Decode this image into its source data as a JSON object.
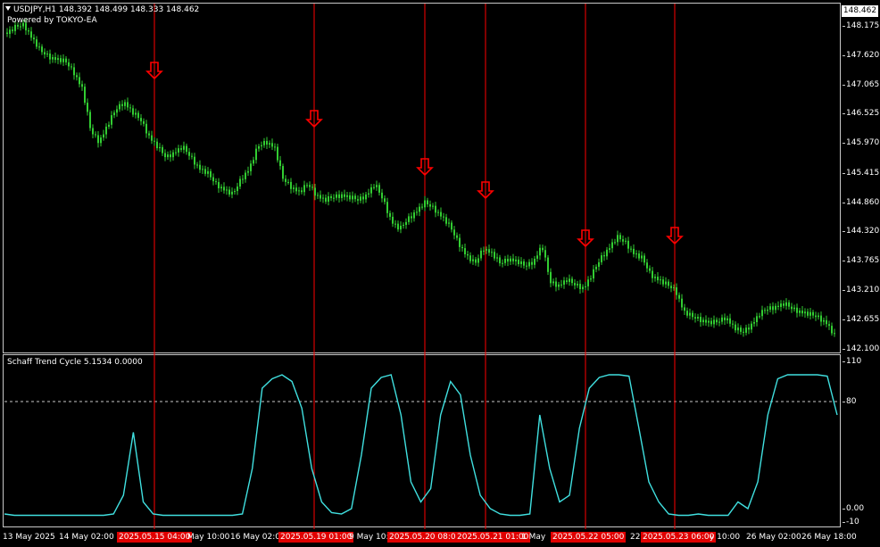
{
  "header": {
    "symbol_line": "USDJPY,H1  148.392 148.499 148.333 148.462",
    "powered_by": "Powered by TOKYO-EA"
  },
  "price_axis": {
    "current_price": "148.462",
    "ticks": [
      "148.175",
      "147.620",
      "147.065",
      "146.525",
      "145.970",
      "145.415",
      "144.860",
      "144.320",
      "143.765",
      "143.210",
      "142.655",
      "142.100"
    ]
  },
  "indicator": {
    "title": "Schaff Trend Cycle 5.1534 0.0000",
    "ticks": [
      "110",
      "80",
      "0.00",
      "-10"
    ]
  },
  "time_axis": {
    "labels": [
      {
        "text": "13 May 2025",
        "red": false
      },
      {
        "text": "14 May 02:00",
        "red": false
      },
      {
        "text": "2025.05.15 04:00",
        "red": true
      },
      {
        "text": "May 10:00",
        "red": false
      },
      {
        "text": "16 May 02:00",
        "red": false
      },
      {
        "text": "2025.05.19 01:00",
        "red": true
      },
      {
        "text": "9 May 10:0",
        "red": false
      },
      {
        "text": "2025.05.20 08:0",
        "red": true
      },
      {
        "text": "2025.05.21 01:00",
        "red": true
      },
      {
        "text": "1 May",
        "red": false
      },
      {
        "text": "2025.05.22 05:00",
        "red": true
      },
      {
        "text": "22",
        "red": false
      },
      {
        "text": "2025.05.23 06:00",
        "red": true
      },
      {
        "text": "y 10:00",
        "red": false
      },
      {
        "text": "26 May 02:00",
        "red": false
      },
      {
        "text": "26 May 18:00",
        "red": false
      }
    ]
  },
  "chart_data": {
    "type": "line",
    "colors": {
      "candles": "#32cd32",
      "signal_lines": "#ff0000",
      "arrows": "#ff0000",
      "stc": "#40e0e0"
    },
    "price_ylim": [
      142.05,
      148.5
    ],
    "stc_ylim": [
      -10,
      110
    ],
    "stc_level": 80,
    "signals": [
      "2025.05.15 04:00",
      "2025.05.19 01:00",
      "2025.05.20 08:00",
      "2025.05.21 01:00",
      "2025.05.22 05:00",
      "2025.05.23 06:00"
    ],
    "price_close": [
      148.05,
      148.15,
      148.2,
      147.95,
      147.7,
      147.6,
      147.55,
      147.5,
      147.3,
      147.0,
      146.2,
      146.0,
      146.3,
      146.6,
      146.75,
      146.55,
      146.4,
      146.1,
      145.9,
      145.7,
      145.8,
      145.9,
      145.7,
      145.5,
      145.4,
      145.2,
      145.1,
      145.0,
      145.3,
      145.5,
      145.9,
      146.0,
      145.9,
      145.3,
      145.15,
      145.05,
      145.2,
      145.0,
      144.9,
      144.95,
      145.0,
      144.95,
      144.9,
      145.0,
      145.2,
      144.9,
      144.5,
      144.35,
      144.55,
      144.7,
      144.85,
      144.75,
      144.6,
      144.4,
      144.1,
      143.85,
      143.7,
      144.0,
      143.9,
      143.7,
      143.8,
      143.75,
      143.65,
      143.75,
      144.05,
      143.35,
      143.3,
      143.4,
      143.3,
      143.25,
      143.5,
      143.8,
      144.0,
      144.2,
      144.1,
      143.9,
      143.8,
      143.5,
      143.4,
      143.3,
      143.2,
      142.8,
      142.7,
      142.65,
      142.6,
      142.6,
      142.7,
      142.5,
      142.4,
      142.55,
      142.75,
      142.85,
      142.9,
      142.95,
      142.85,
      142.8,
      142.75,
      142.7,
      142.6,
      142.35
    ],
    "stc_values": [
      -4,
      -5,
      -5,
      -5,
      -5,
      -5,
      -5,
      -5,
      -5,
      -5,
      -5,
      -4,
      10,
      57,
      5,
      -4,
      -5,
      -5,
      -5,
      -5,
      -5,
      -5,
      -5,
      -5,
      -4,
      30,
      90,
      97,
      100,
      95,
      75,
      30,
      5,
      -3,
      -4,
      0,
      40,
      90,
      98,
      100,
      70,
      20,
      5,
      15,
      70,
      95,
      85,
      40,
      10,
      0,
      -4,
      -5,
      -5,
      -4,
      70,
      30,
      5,
      10,
      60,
      90,
      98,
      100,
      100,
      99,
      60,
      20,
      5,
      -4,
      -5,
      -5,
      -4,
      -5,
      -5,
      -5,
      5,
      0,
      20,
      70,
      97,
      100,
      100,
      100,
      100,
      99,
      70
    ],
    "stc_x": [
      0,
      0.03,
      0.06,
      0.09,
      0.12,
      0.14,
      0.155,
      0.17,
      0.174,
      0.18,
      0.185,
      0.19,
      0.2,
      0.22,
      0.24,
      0.26,
      0.28,
      0.3,
      0.31,
      0.315,
      0.32,
      0.33,
      0.345,
      0.36,
      0.375,
      0.38,
      0.39,
      0.41,
      0.43,
      0.45,
      0.46,
      0.47,
      0.48,
      0.49,
      0.5,
      0.51,
      0.52,
      0.53,
      0.54,
      0.56,
      0.575,
      0.585,
      0.6,
      0.62,
      0.635,
      0.65,
      0.665,
      0.675,
      0.685,
      0.695,
      0.705,
      0.72,
      0.74,
      0.76,
      0.775,
      0.79,
      0.805,
      0.815,
      0.83,
      0.85,
      0.865,
      0.88,
      0.895,
      0.905,
      0.915,
      0.925,
      0.935,
      0.945,
      0.955,
      0.965,
      0.975,
      0.985,
      0.99,
      0.995,
      1.0,
      1.0,
      1.0,
      1.0,
      1.0,
      1.0,
      1.0,
      1.0,
      1.0,
      1.0,
      1.0
    ]
  }
}
